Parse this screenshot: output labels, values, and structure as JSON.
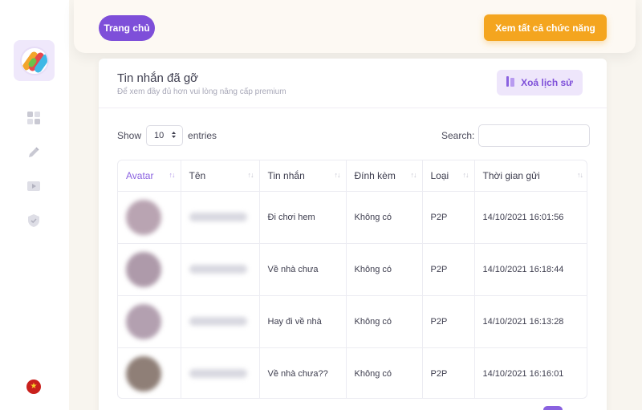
{
  "sidebar": {
    "logo_icon": "app-logo-icon",
    "icons": [
      "dashboard-icon",
      "pencil-icon",
      "video-icon",
      "shield-check-icon"
    ],
    "flag_icon": "vietnam-flag-icon",
    "colors": {
      "accent": "#7e4fd9",
      "logo_bg": "#efe8fb"
    }
  },
  "header": {
    "home_label": "Trang chủ",
    "all_features_label": "Xem tất cả chức năng",
    "colors": {
      "home": "#7e4fd9",
      "all_features": "#f4a51f"
    }
  },
  "card": {
    "title": "Tin nhắn đã gỡ",
    "subtitle": "Để xem đầy đủ hơn vui lòng nâng cấp premium",
    "clear_label": "Xoá lịch sử",
    "clear_icon": "trash-icon"
  },
  "controls": {
    "show_label": "Show",
    "entries_value": "10",
    "entries_label": "entries",
    "search_label": "Search:",
    "search_value": ""
  },
  "table": {
    "columns": [
      "Avatar",
      "Tên",
      "Tin nhắn",
      "Đính kèm",
      "Loại",
      "Thời gian gửi"
    ],
    "rows": [
      {
        "message": "Đi chơi hem",
        "attachment": "Không có",
        "type": "P2P",
        "time": "14/10/2021 16:01:56"
      },
      {
        "message": "Về nhà chưa",
        "attachment": "Không có",
        "type": "P2P",
        "time": "14/10/2021 16:18:44"
      },
      {
        "message": "Hay đi về nhà",
        "attachment": "Không có",
        "type": "P2P",
        "time": "14/10/2021 16:13:28"
      },
      {
        "message": "Về nhà chưa??",
        "attachment": "Không có",
        "type": "P2P",
        "time": "14/10/2021 16:16:01"
      }
    ]
  }
}
